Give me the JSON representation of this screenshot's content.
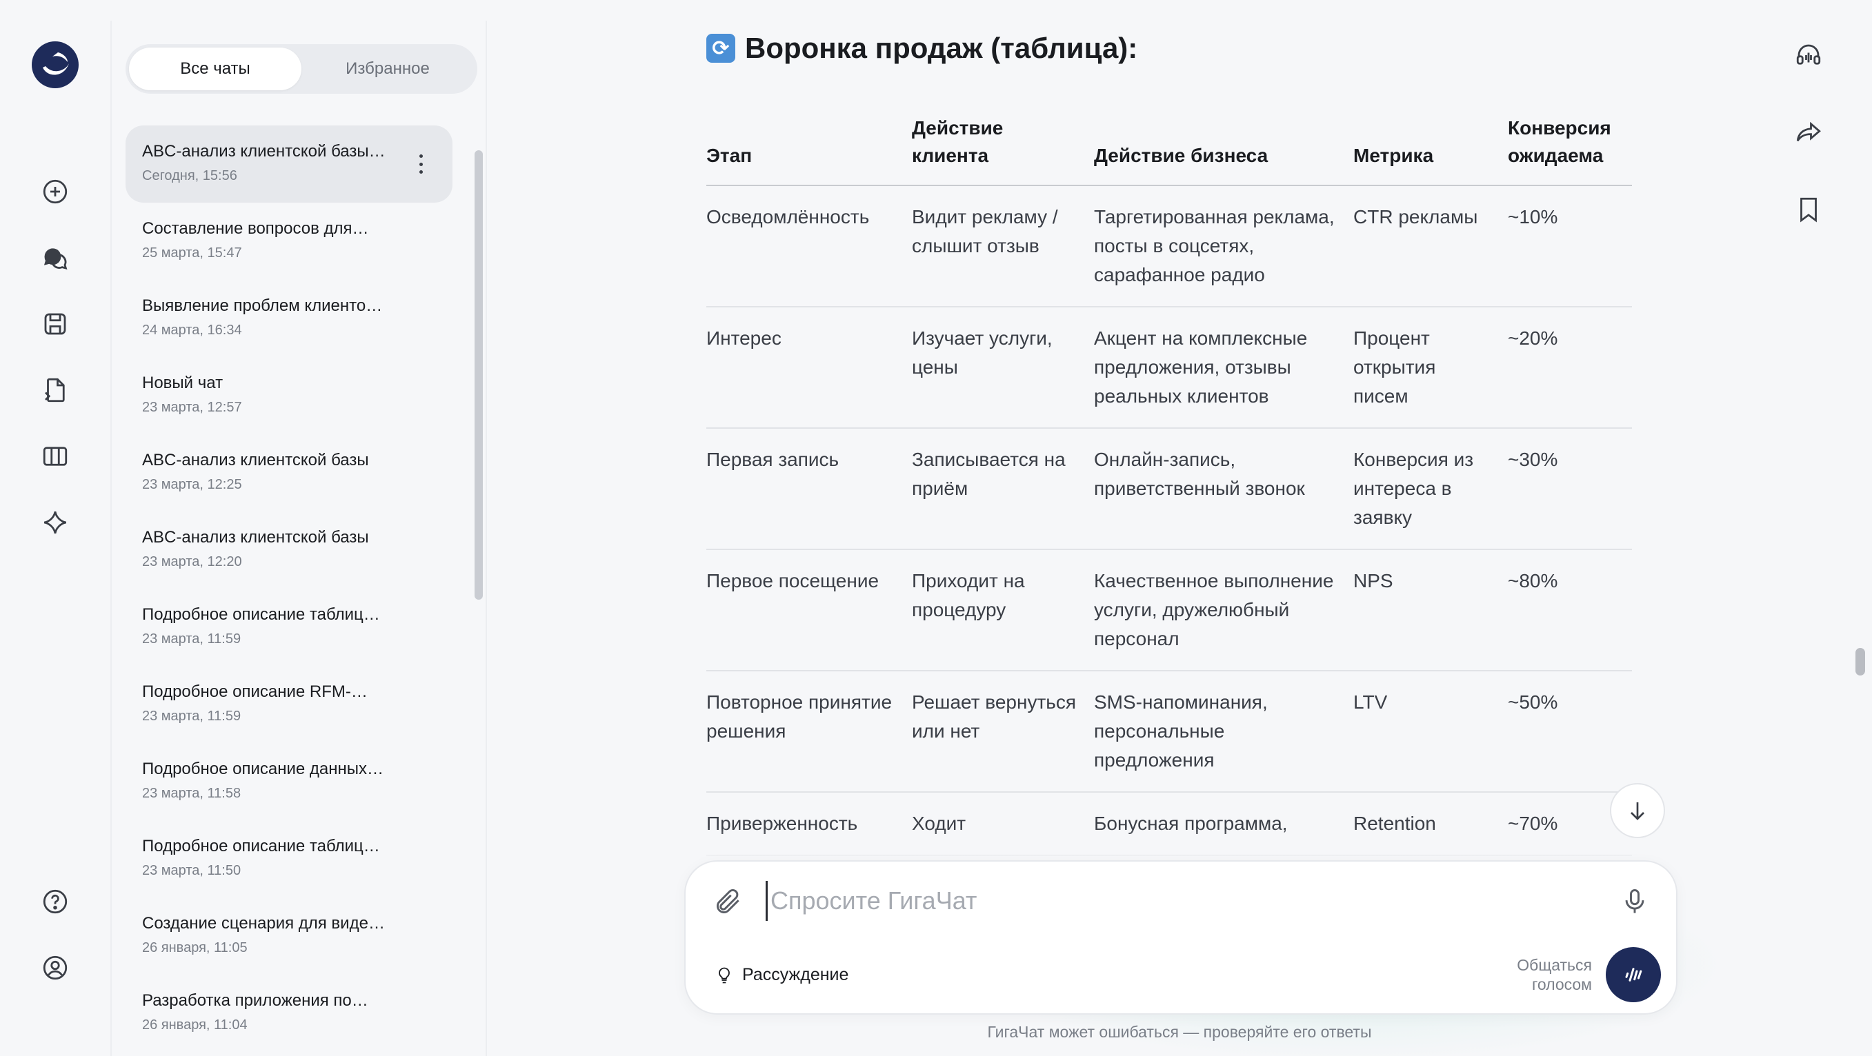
{
  "sidebar": {
    "tabs": [
      {
        "label": "Все чаты",
        "active": true
      },
      {
        "label": "Избранное",
        "active": false
      }
    ],
    "chats": [
      {
        "title": "ABC-анализ клиентской базы…",
        "date": "Сегодня, 15:56",
        "active": true
      },
      {
        "title": "Составление вопросов для…",
        "date": "25 марта, 15:47"
      },
      {
        "title": "Выявление проблем клиенто…",
        "date": "24 марта, 16:34"
      },
      {
        "title": "Новый чат",
        "date": "23 марта, 12:57"
      },
      {
        "title": "ABC-анализ клиентской базы",
        "date": "23 марта, 12:25"
      },
      {
        "title": "ABC-анализ клиентской базы",
        "date": "23 марта, 12:20"
      },
      {
        "title": "Подробное описание таблиц…",
        "date": "23 марта, 11:59"
      },
      {
        "title": "Подробное описание RFM-…",
        "date": "23 марта, 11:59"
      },
      {
        "title": "Подробное описание данных…",
        "date": "23 марта, 11:58"
      },
      {
        "title": "Подробное описание таблиц…",
        "date": "23 марта, 11:50"
      },
      {
        "title": "Создание сценария для виде…",
        "date": "26 января, 11:05"
      },
      {
        "title": "Разработка приложения по…",
        "date": "26 января, 11:04"
      }
    ]
  },
  "rail_icons": [
    "logo-icon",
    "new-chat-icon",
    "chats-icon",
    "saved-icon",
    "files-icon",
    "library-icon",
    "sparkle-icon",
    "help-icon",
    "profile-icon"
  ],
  "main": {
    "title_emoji": "🔄",
    "title": "Воронка продаж (таблица):",
    "table": {
      "headers": [
        "Этап",
        "Действие клиента",
        "Действие бизнеса",
        "Метрика",
        "Конверсия ожидаема"
      ],
      "rows": [
        [
          "Осведомлённость",
          "Видит рекламу / слышит отзыв",
          "Таргетированная реклама, посты в соцсетях, сарафанное радио",
          "CTR рекламы",
          "~10%"
        ],
        [
          "Интерес",
          "Изучает услуги, цены",
          "Акцент на комплексные предложения, отзывы реальных клиентов",
          "Процент открытия писем",
          "~20%"
        ],
        [
          "Первая запись",
          "Записывается на приём",
          "Онлайн-запись, приветственный звонок",
          "Конверсия из интереса в заявку",
          "~30%"
        ],
        [
          "Первое посещение",
          "Приходит на процедуру",
          "Качественное выполнение услуги, дружелюбный персонал",
          "NPS",
          "~80%"
        ],
        [
          "Повторное принятие решения",
          "Решает вернуться или нет",
          "SMS-напоминания, персональные предложения",
          "LTV",
          "~50%"
        ],
        [
          "Приверженность",
          "Ходит",
          "Бонусная программа,",
          "Retention",
          "~70%"
        ]
      ]
    }
  },
  "composer": {
    "placeholder": "Спросите ГигаЧат",
    "reasoning_label": "Рассуждение",
    "voice_label": "Общаться голосом"
  },
  "disclaimer": "ГигаЧат может ошибаться — проверяйте его ответы",
  "right_icons": [
    "headset-icon",
    "share-icon",
    "bookmark-icon"
  ]
}
